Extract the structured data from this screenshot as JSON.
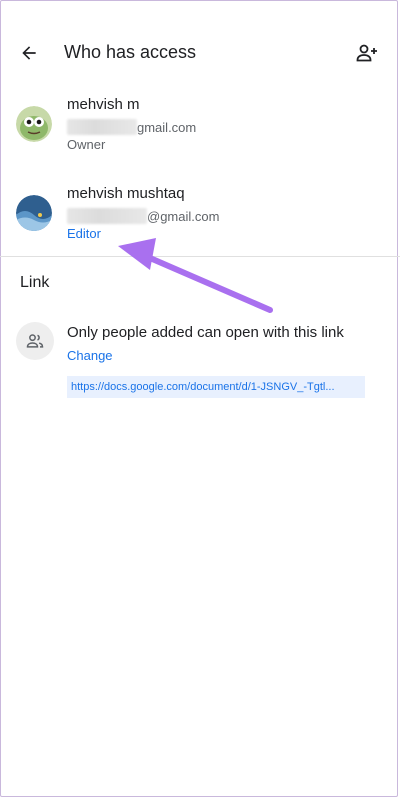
{
  "header": {
    "title": "Who has access"
  },
  "people": [
    {
      "name": "mehvish m",
      "email_suffix": "gmail.com",
      "role": "Owner"
    },
    {
      "name": "mehvish mushtaq",
      "email_suffix": "@gmail.com",
      "role": "Editor"
    }
  ],
  "link_section": {
    "title": "Link",
    "description": "Only people added can open with this link",
    "change_label": "Change",
    "url": "https://docs.google.com/document/d/1-JSNGV_-Tgtl..."
  },
  "icons": {
    "back": "arrow-left-icon",
    "add_person": "person-add-icon",
    "link_group": "people-icon"
  },
  "colors": {
    "accent": "#1a73e8",
    "url_bg": "#e8f0fe",
    "annotation": "#a970ef"
  }
}
